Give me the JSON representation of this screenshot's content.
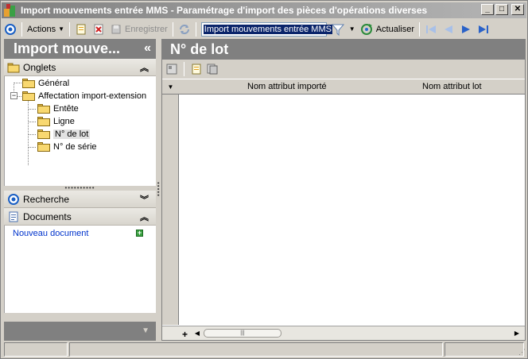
{
  "window": {
    "title": "Import mouvements entrée MMS  -  Paramétrage d'import des pièces d'opérations diverses",
    "minimize": "_",
    "maximize": "□",
    "close": "✕"
  },
  "toolbar": {
    "actions_label": "Actions",
    "save_label": "Enregistrer",
    "search_value": "Import mouvements entrée MMS",
    "refresh_label": "Actualiser"
  },
  "left_panel": {
    "header": "Import mouve...",
    "collapse": "«",
    "tabs_group": {
      "label": "Onglets",
      "chevron": "⌃",
      "tree": [
        {
          "label": "Général"
        },
        {
          "label": "Affectation import-extension",
          "expander": "−"
        },
        {
          "label": "Entête"
        },
        {
          "label": "Ligne"
        },
        {
          "label": "N° de lot",
          "selected": true
        },
        {
          "label": "N° de série"
        }
      ]
    },
    "search_group": {
      "label": "Recherche"
    },
    "documents_group": {
      "label": "Documents",
      "new_document": "Nouveau document"
    }
  },
  "right_panel": {
    "header": "N° de lot",
    "columns": [
      "Nom attribut importé",
      "Nom attribut lot"
    ],
    "scroll_plus": "+",
    "thumb_grip": "|||"
  },
  "colors": {
    "panel_header": "#808080",
    "window_bg": "#d4d0c8",
    "link": "#0033cc"
  }
}
